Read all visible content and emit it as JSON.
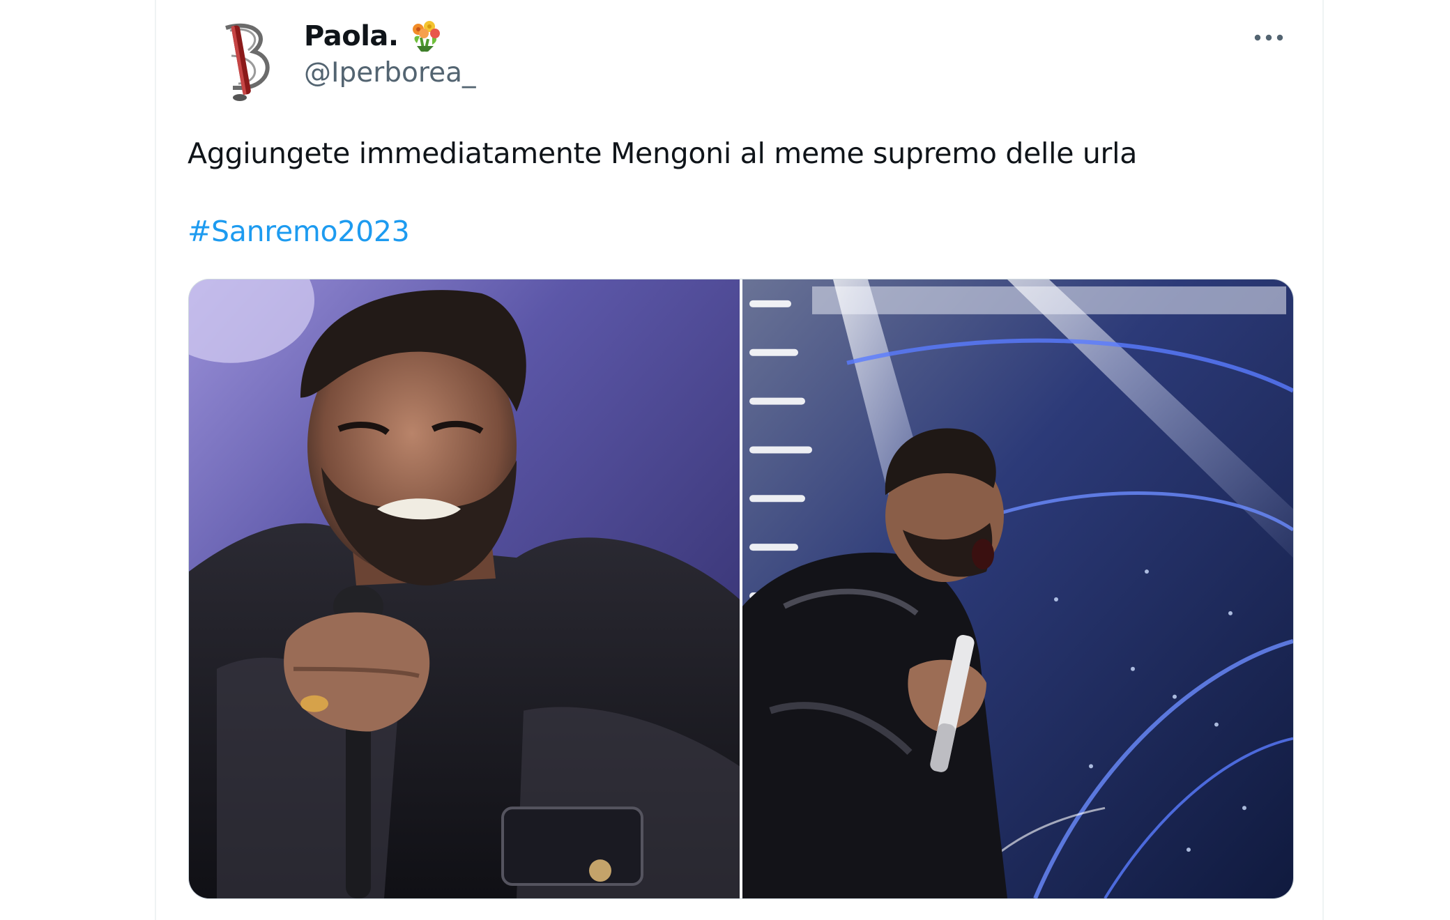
{
  "tweet": {
    "author": {
      "display_name": "Paola.",
      "handle": "@Iperborea_",
      "badge_icon": "bouquet-emoji-icon"
    },
    "more_icon": "more-options-icon",
    "text": "Aggiungete immediatamente Mengoni al meme supremo delle urla",
    "hashtag": "#Sanremo2023",
    "media": [
      {
        "icon": "photo-closeup-singer"
      },
      {
        "icon": "photo-stage-singer"
      }
    ]
  },
  "colors": {
    "text_primary": "#0f1419",
    "text_secondary": "#536471",
    "link": "#1d9bf0",
    "border": "#eff3f4"
  }
}
